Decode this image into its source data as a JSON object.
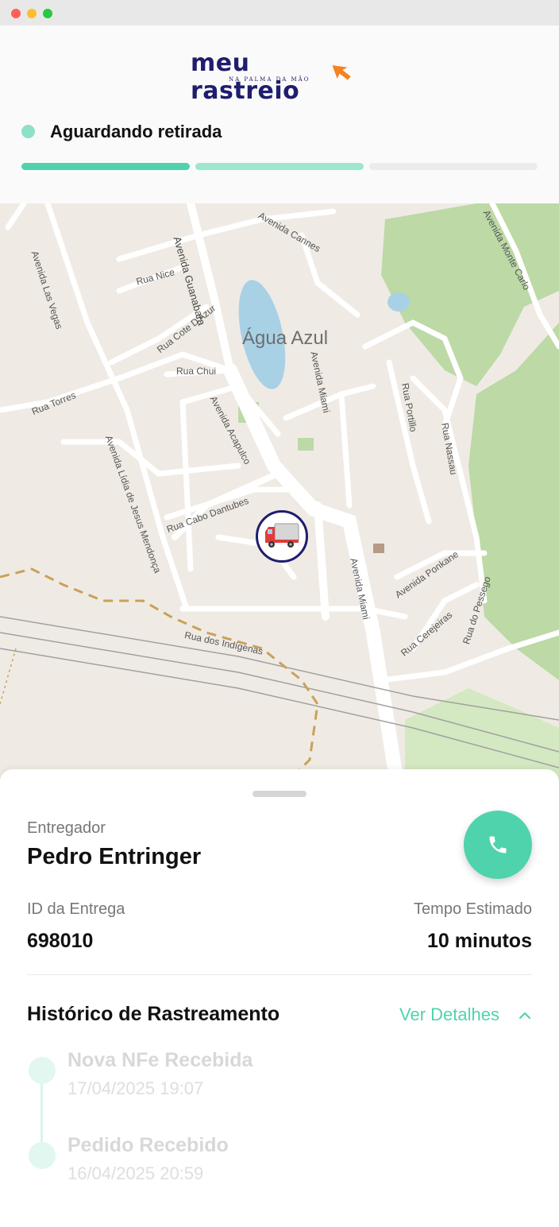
{
  "window": {
    "controls": [
      "close",
      "minimize",
      "maximize"
    ]
  },
  "brand": {
    "name": "meu rastreio",
    "tagline": "NA PALMA DA MÃO",
    "primary_color": "#1f1d6e",
    "accent_color": "#f5821f"
  },
  "status": {
    "label": "Aguardando retirada",
    "steps_total": 3,
    "steps_done": 1,
    "steps_partial": 1,
    "color": "#4fd3ad"
  },
  "map": {
    "area_label": "Água Azul",
    "marker_icon": "truck-icon",
    "street_labels": {
      "s1": "Avenida Las Vegas",
      "s2": "Avenida Guanabara",
      "s3": "Avenida Cannes",
      "s4": "Rua Nice",
      "s5": "Rua Cote D'Azur",
      "s6": "Rua Chui",
      "s7": "Rua Torres",
      "s8": "Avenida Miami",
      "s9": "Rua Portillo",
      "s10": "Rua Nassau",
      "s11": "Avenida Acapulco",
      "s12": "Avenida Lídia de Jesus Mendonça",
      "s13": "Rua Cabo Dantubes",
      "s14": "Avenida Ponkane",
      "s15": "Avenida Miami",
      "s16": "Rua Cerejeiras",
      "s17": "Rua do Pessego",
      "s18": "Rua dos Indígenas",
      "s19": "Avenida Monte Carlo",
      "s20": "Rua"
    }
  },
  "delivery": {
    "courier_label": "Entregador",
    "courier_name": "Pedro Entringer",
    "id_label": "ID da Entrega",
    "id_value": "698010",
    "eta_label": "Tempo Estimado",
    "eta_value": "10 minutos",
    "call_icon": "phone-icon"
  },
  "history": {
    "title": "Histórico de Rastreamento",
    "toggle_label": "Ver Detalhes",
    "toggle_icon": "chevron-up-icon",
    "events": [
      {
        "title": "Nova NFe Recebida",
        "date": "17/04/2025 19:07"
      },
      {
        "title": "Pedido Recebido",
        "date": "16/04/2025 20:59"
      }
    ]
  }
}
